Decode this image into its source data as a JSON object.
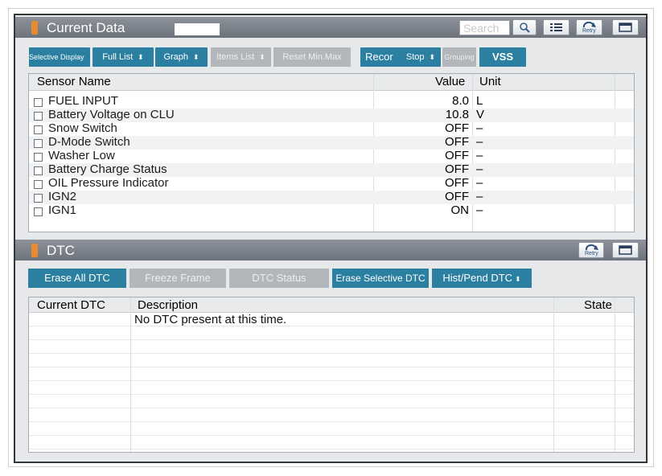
{
  "current_data": {
    "title": "Current Data",
    "search_placeholder": "Search",
    "retry_label": "Retry",
    "toolbar": {
      "selective_display": "Selective Display",
      "full_list": "Full List",
      "graph": "Graph",
      "items_list": "Items List",
      "reset_min_max": "Reset Min.Max",
      "record": "Recor",
      "stop": "Stop",
      "grouping": "Grouping",
      "vss": "VSS"
    },
    "columns": {
      "sensor_name": "Sensor Name",
      "value": "Value",
      "unit": "Unit"
    },
    "rows": [
      {
        "name": "FUEL INPUT",
        "value": "8.0",
        "unit": "L"
      },
      {
        "name": "Battery Voltage on CLU",
        "value": "10.8",
        "unit": "V"
      },
      {
        "name": "Snow Switch",
        "value": "OFF",
        "unit": "–"
      },
      {
        "name": "D-Mode Switch",
        "value": "OFF",
        "unit": "–"
      },
      {
        "name": "Washer Low",
        "value": "OFF",
        "unit": "–"
      },
      {
        "name": "Battery Charge Status",
        "value": "OFF",
        "unit": "–"
      },
      {
        "name": "OIL Pressure Indicator",
        "value": "OFF",
        "unit": "–"
      },
      {
        "name": "IGN2",
        "value": "OFF",
        "unit": "–"
      },
      {
        "name": "IGN1",
        "value": "ON",
        "unit": "–"
      }
    ]
  },
  "dtc": {
    "title": "DTC",
    "retry_label": "Retry",
    "toolbar": {
      "erase_all": "Erase All DTC",
      "freeze_frame": "Freeze Frame",
      "dtc_status": "DTC Status",
      "erase_selective": "Erase Selective DTC",
      "hist_pend": "Hist/Pend DTC"
    },
    "columns": {
      "current_dtc": "Current DTC",
      "description": "Description",
      "state": "State"
    },
    "message": "No DTC present at this time."
  },
  "colors": {
    "accent": "#2b7fa0",
    "header": "#6d737c",
    "marker": "#e98a2e",
    "disabled": "#b3b6ba"
  },
  "icons": [
    "search-icon",
    "list-icon",
    "retry-icon",
    "maximize-icon"
  ]
}
